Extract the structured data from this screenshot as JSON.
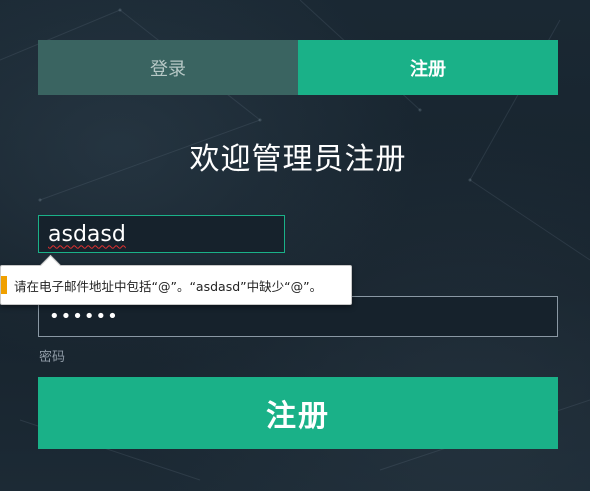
{
  "tabs": {
    "login_label": "登录",
    "register_label": "注册",
    "active": "register"
  },
  "title": "欢迎管理员注册",
  "email": {
    "value": "asdasd"
  },
  "validation": {
    "message": "请在电子邮件地址中包括“@”。“asdasd”中缺少“@”。"
  },
  "password": {
    "value": "••••••",
    "label": "密码"
  },
  "submit_label": "注册",
  "colors": {
    "accent": "#1ab188",
    "inactive_tab": "#3a6461",
    "background": "#1a2733",
    "warning": "#f0a000"
  }
}
